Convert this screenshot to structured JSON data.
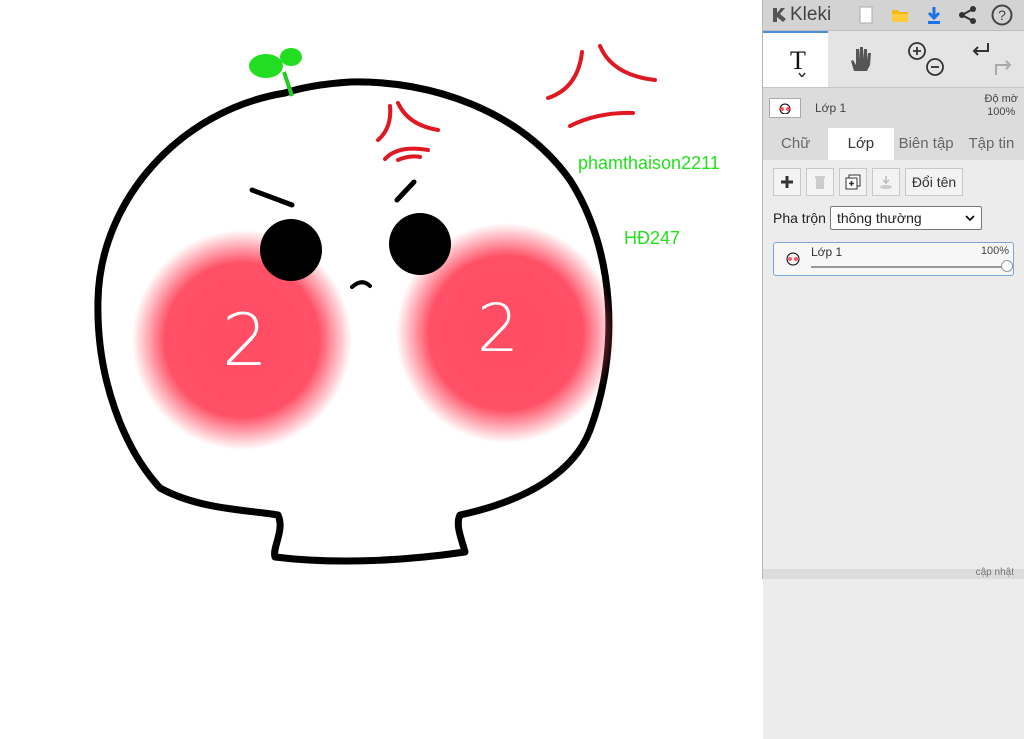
{
  "canvas": {
    "texts": [
      "phamthaison2211",
      "HĐ247"
    ],
    "cheek_digits": [
      "2",
      "2"
    ]
  },
  "toolbar": {
    "app_name": "Kleki"
  },
  "tools": [
    "text-tool",
    "hand-tool",
    "zoom-tool",
    "undo-redo"
  ],
  "layer_header": {
    "name": "Lớp 1",
    "opacity_label": "Độ mờ",
    "opacity_value": "100%"
  },
  "tabs": [
    "Chữ",
    "Lớp",
    "Biên tập",
    "Tập tin"
  ],
  "active_tab": "Lớp",
  "layers_panel": {
    "rename_label": "Đổi tên",
    "blend_label": "Pha trộn",
    "blend_value": "thông thường",
    "layer_name": "Lớp 1",
    "layer_opacity": "100%"
  },
  "footer": {
    "update_label": "cập nhật"
  },
  "colors": {
    "accent": "#4a90d9",
    "annotation_green": "#22e01a"
  }
}
